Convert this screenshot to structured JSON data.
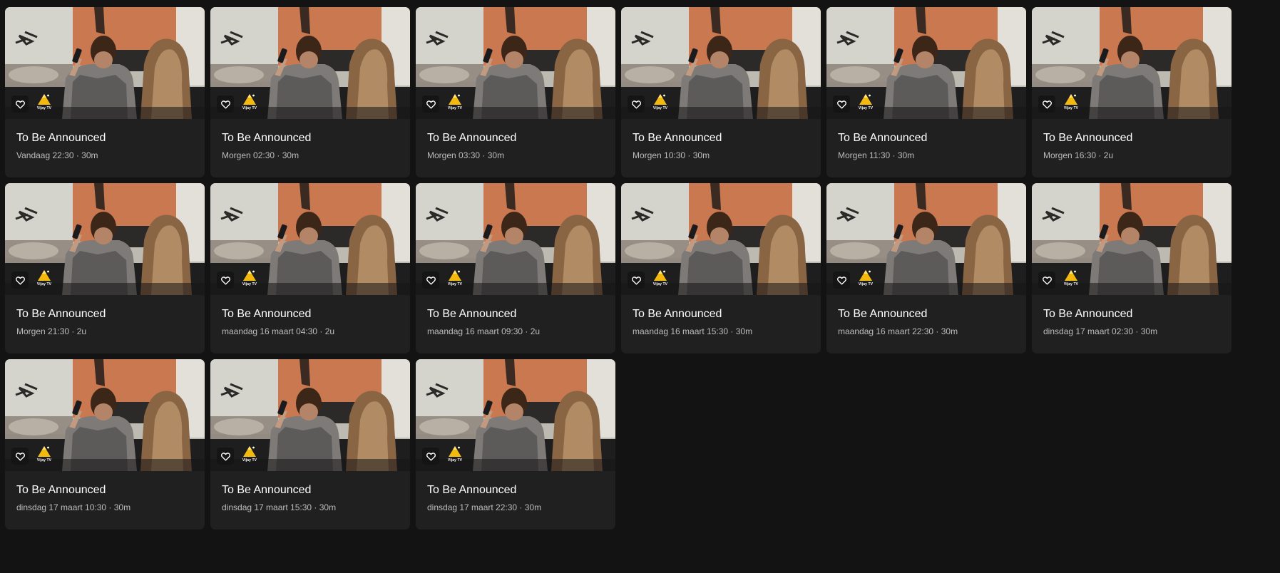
{
  "colors": {
    "background": "#131313",
    "card": "#202020",
    "channel_logo_yellow": "#f4b90f",
    "meta_text": "#bdbdbd"
  },
  "cards": [
    {
      "title": "To Be Announced",
      "meta": "Vandaag 22:30 · 30m",
      "channel": "Vijay TV",
      "icons": [
        "heart-icon",
        "channel-logo"
      ]
    },
    {
      "title": "To Be Announced",
      "meta": "Morgen 02:30 · 30m",
      "channel": "Vijay TV",
      "icons": [
        "heart-icon",
        "channel-logo"
      ]
    },
    {
      "title": "To Be Announced",
      "meta": "Morgen 03:30 · 30m",
      "channel": "Vijay TV",
      "icons": [
        "heart-icon",
        "channel-logo"
      ]
    },
    {
      "title": "To Be Announced",
      "meta": "Morgen 10:30 · 30m",
      "channel": "Vijay TV",
      "icons": [
        "heart-icon",
        "channel-logo"
      ]
    },
    {
      "title": "To Be Announced",
      "meta": "Morgen 11:30 · 30m",
      "channel": "Vijay TV",
      "icons": [
        "heart-icon",
        "channel-logo"
      ]
    },
    {
      "title": "To Be Announced",
      "meta": "Morgen 16:30 · 2u",
      "channel": "Vijay TV",
      "icons": [
        "heart-icon",
        "channel-logo"
      ]
    },
    {
      "title": "To Be Announced",
      "meta": "Morgen 21:30 · 2u",
      "channel": "Vijay TV",
      "icons": [
        "heart-icon",
        "channel-logo"
      ]
    },
    {
      "title": "To Be Announced",
      "meta": "maandag 16 maart 04:30 · 2u",
      "channel": "Vijay TV",
      "icons": [
        "heart-icon",
        "channel-logo"
      ]
    },
    {
      "title": "To Be Announced",
      "meta": "maandag 16 maart 09:30 · 2u",
      "channel": "Vijay TV",
      "icons": [
        "heart-icon",
        "channel-logo"
      ]
    },
    {
      "title": "To Be Announced",
      "meta": "maandag 16 maart 15:30 · 30m",
      "channel": "Vijay TV",
      "icons": [
        "heart-icon",
        "channel-logo"
      ]
    },
    {
      "title": "To Be Announced",
      "meta": "maandag 16 maart 22:30 · 30m",
      "channel": "Vijay TV",
      "icons": [
        "heart-icon",
        "channel-logo"
      ]
    },
    {
      "title": "To Be Announced",
      "meta": "dinsdag 17 maart 02:30 · 30m",
      "channel": "Vijay TV",
      "icons": [
        "heart-icon",
        "channel-logo"
      ]
    },
    {
      "title": "To Be Announced",
      "meta": "dinsdag 17 maart 10:30 · 30m",
      "channel": "Vijay TV",
      "icons": [
        "heart-icon",
        "channel-logo"
      ]
    },
    {
      "title": "To Be Announced",
      "meta": "dinsdag 17 maart 15:30 · 30m",
      "channel": "Vijay TV",
      "icons": [
        "heart-icon",
        "channel-logo"
      ]
    },
    {
      "title": "To Be Announced",
      "meta": "dinsdag 17 maart 22:30 · 30m",
      "channel": "Vijay TV",
      "icons": [
        "heart-icon",
        "channel-logo"
      ]
    }
  ]
}
